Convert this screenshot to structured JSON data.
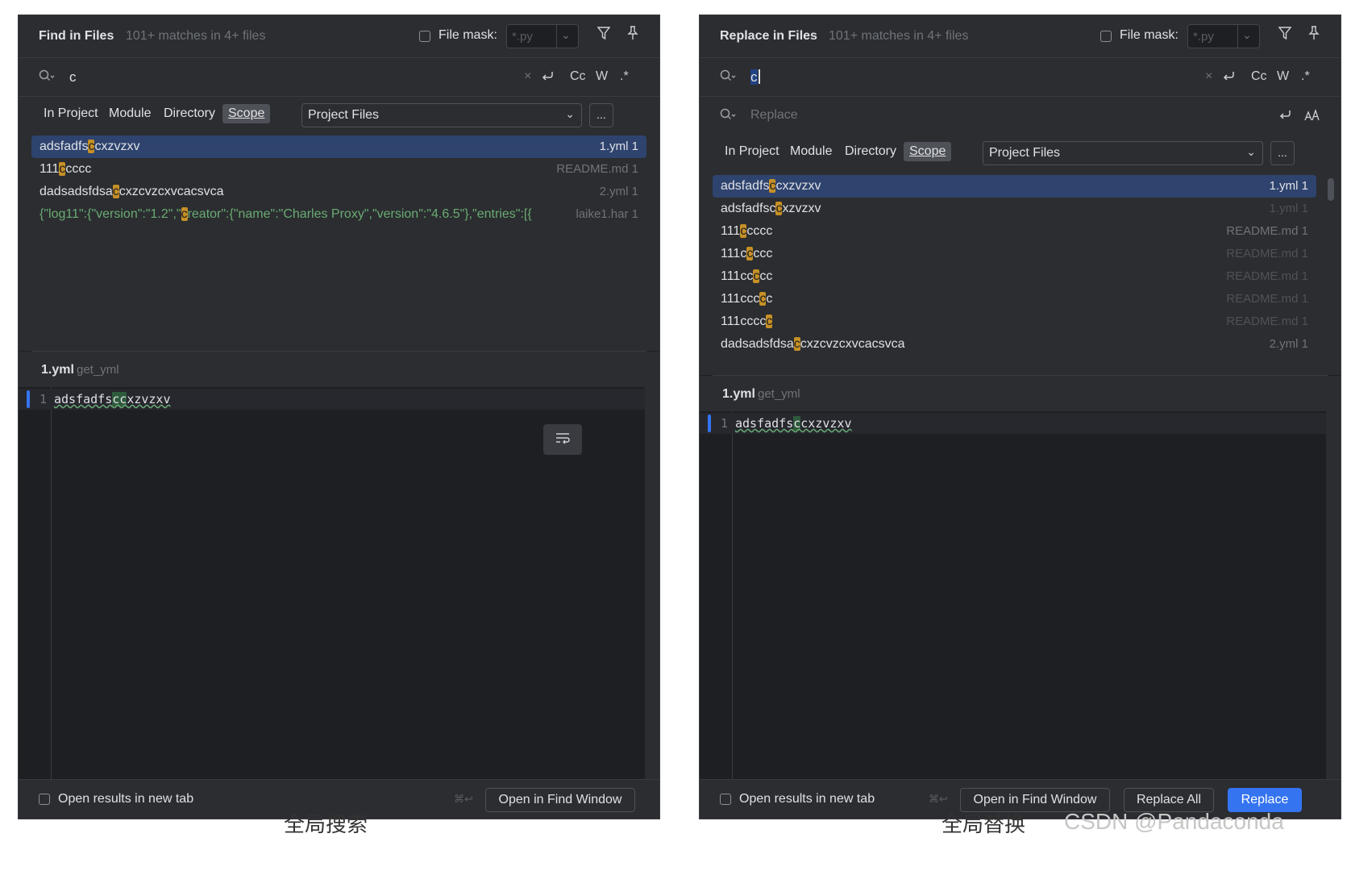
{
  "left_panel": {
    "title": "Find in Files",
    "match_count": "101+ matches in 4+ files",
    "file_mask_label": "File mask:",
    "file_mask_placeholder": "*.py",
    "search_query": "c",
    "option_cc": "Cc",
    "option_w": "W",
    "option_regex": ".*",
    "scope_tabs": [
      "In Project",
      "Module",
      "Directory",
      "Scope"
    ],
    "scope_value": "Project Files",
    "more_label": "...",
    "results": [
      {
        "pre": "adsfadfs",
        "hl": "c",
        "post": "cxzvzxv",
        "file": "1.yml 1"
      },
      {
        "pre": "111",
        "hl": "c",
        "post": "cccc",
        "file": "README.md 1"
      },
      {
        "pre": "dadsadsfdsa",
        "hl": "c",
        "post": "cxzcvzcxvcacsvca",
        "file": "2.yml 1"
      },
      {
        "pre": "{\"log11\":{\"version\":\"1.2\",\"",
        "hl": "c",
        "post": "reator\":{\"name\":\"Charles Proxy\",\"version\":\"4.6.5\"},\"entries\":[{",
        "file": "laike1.har 1"
      }
    ],
    "preview_file": "1.yml",
    "preview_fn": "get_yml",
    "line_number": "1",
    "code_pre": "adsfadfs",
    "code_hl": "cc",
    "code_post": "xzvzxv",
    "open_new_tab": "Open results in new tab",
    "shortcut": "⌘↩",
    "open_find_window": "Open in Find Window"
  },
  "right_panel": {
    "title": "Replace in Files",
    "match_count": "101+ matches in 4+ files",
    "file_mask_label": "File mask:",
    "file_mask_placeholder": "*.py",
    "search_query": "c",
    "replace_placeholder": "Replace",
    "option_cc": "Cc",
    "option_w": "W",
    "option_regex": ".*",
    "scope_tabs": [
      "In Project",
      "Module",
      "Directory",
      "Scope"
    ],
    "scope_value": "Project Files",
    "more_label": "...",
    "results": [
      {
        "pre": "adsfadfs",
        "hl": "c",
        "post": "cxzvzxv",
        "file": "1.yml 1"
      },
      {
        "pre": "adsfadfsc",
        "hl": "c",
        "post": "xzvzxv",
        "file": "1.yml 1"
      },
      {
        "pre": "111",
        "hl": "c",
        "post": "cccc",
        "file": "README.md 1"
      },
      {
        "pre": "111c",
        "hl": "c",
        "post": "ccc",
        "file": "README.md 1"
      },
      {
        "pre": "111cc",
        "hl": "c",
        "post": "cc",
        "file": "README.md 1"
      },
      {
        "pre": "111ccc",
        "hl": "c",
        "post": "c",
        "file": "README.md 1"
      },
      {
        "pre": "111cccc",
        "hl": "c",
        "post": "",
        "file": "README.md 1"
      },
      {
        "pre": "dadsadsfdsa",
        "hl": "c",
        "post": "cxzcvzcxvcacsvca",
        "file": "2.yml 1"
      }
    ],
    "preview_file": "1.yml",
    "preview_fn": "get_yml",
    "line_number": "1",
    "code_pre": "adsfadfs",
    "code_hl": "c",
    "code_post": "cxzvzxv",
    "open_new_tab": "Open results in new tab",
    "shortcut": "⌘↩",
    "open_find_window": "Open in Find Window",
    "replace_all": "Replace All",
    "replace": "Replace"
  },
  "captions": {
    "left": "全局搜索",
    "right": "全局替换",
    "watermark": "CSDN @Pandaconda"
  },
  "colors": {
    "accent": "#3574f0",
    "selection": "#2e436e",
    "match_highlight": "#c69026",
    "panel_bg": "#2b2d30",
    "editor_bg": "#1e1f22"
  }
}
